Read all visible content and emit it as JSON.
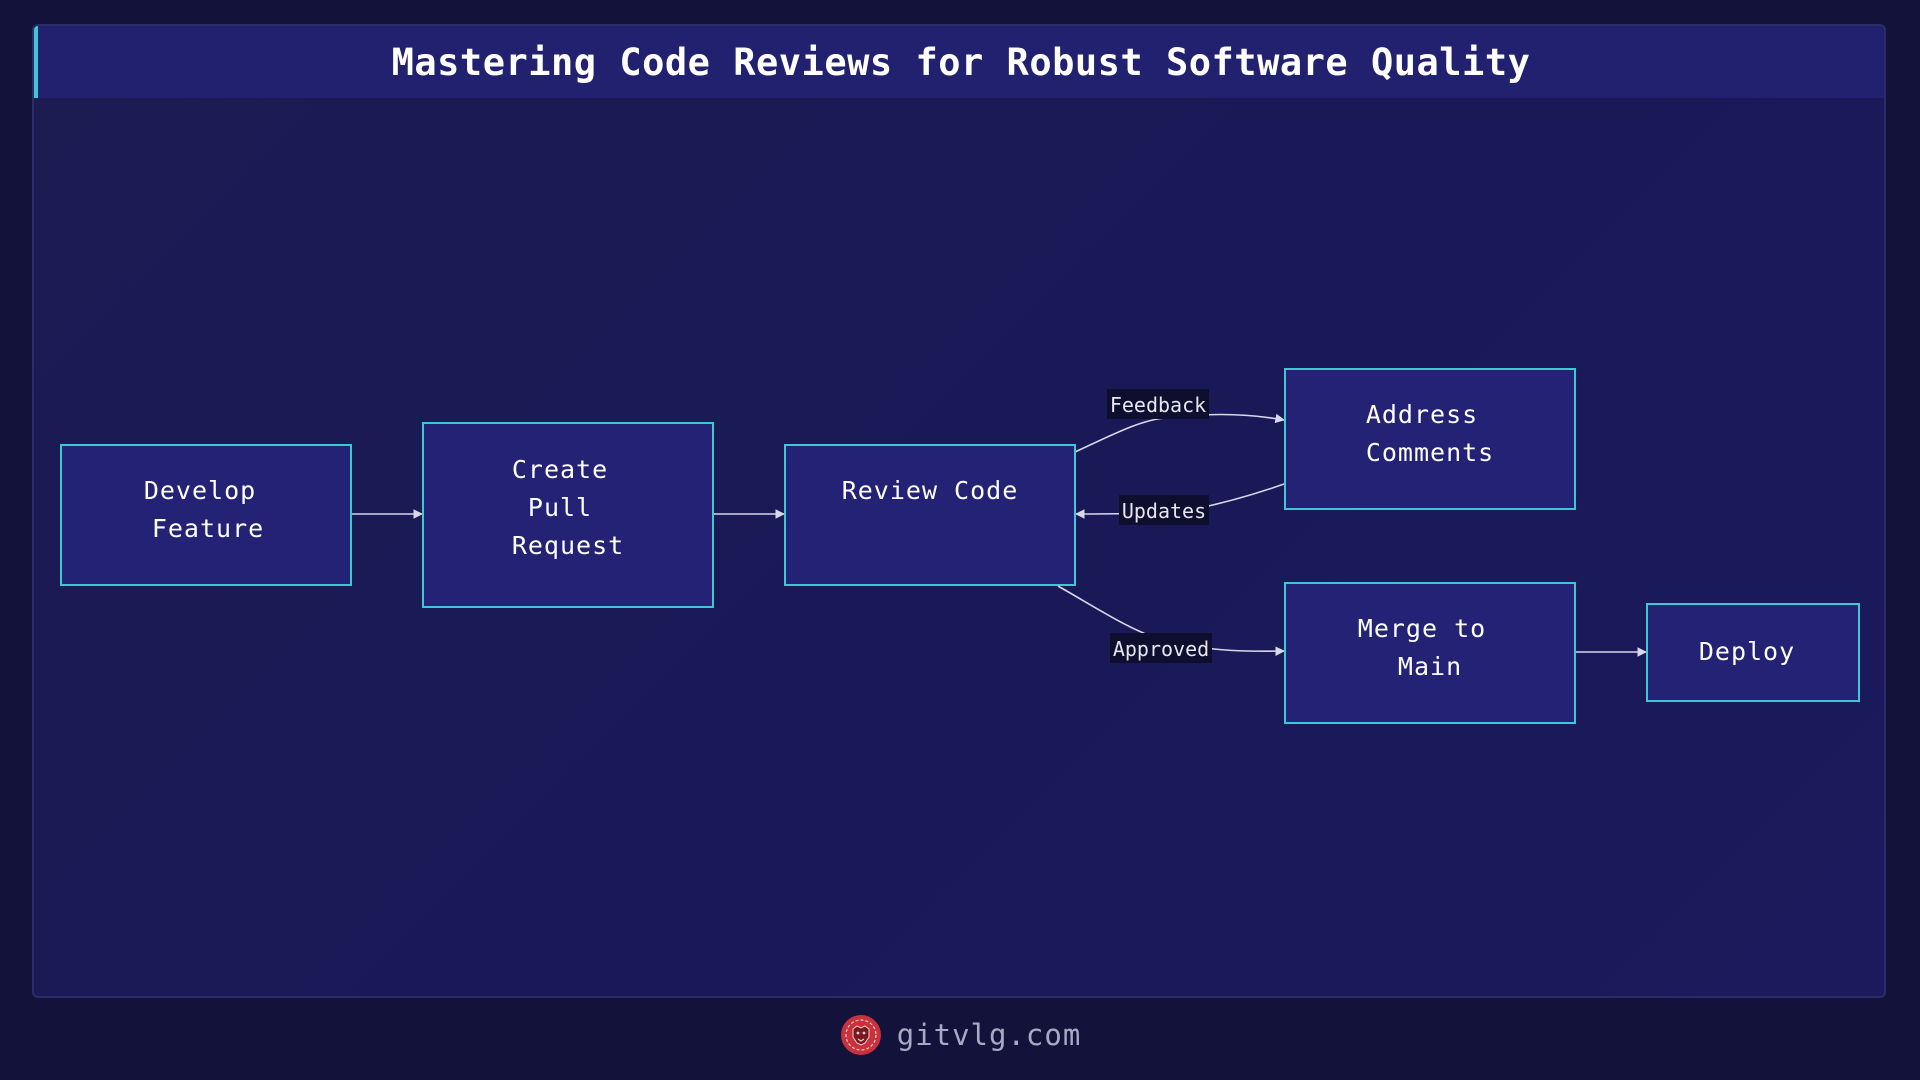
{
  "title": "Mastering Code Reviews for Robust Software Quality",
  "nodes": {
    "develop": [
      "Develop",
      " Feature"
    ],
    "create_pr": [
      "Create",
      "Pull",
      " Request"
    ],
    "review": [
      "Review Code"
    ],
    "address": [
      "Address",
      " Comments"
    ],
    "merge": [
      "Merge to",
      " Main"
    ],
    "deploy": [
      "Deploy"
    ]
  },
  "edges": {
    "feedback": "Feedback",
    "updates": "Updates",
    "approved": "Approved"
  },
  "footer": {
    "brand": "gitvlg.com",
    "logo_icon": "lion-head-icon"
  },
  "colors": {
    "background": "#12123a",
    "node_fill": "#232275",
    "node_border": "#3ec8d4",
    "logo": "#c8323c"
  }
}
